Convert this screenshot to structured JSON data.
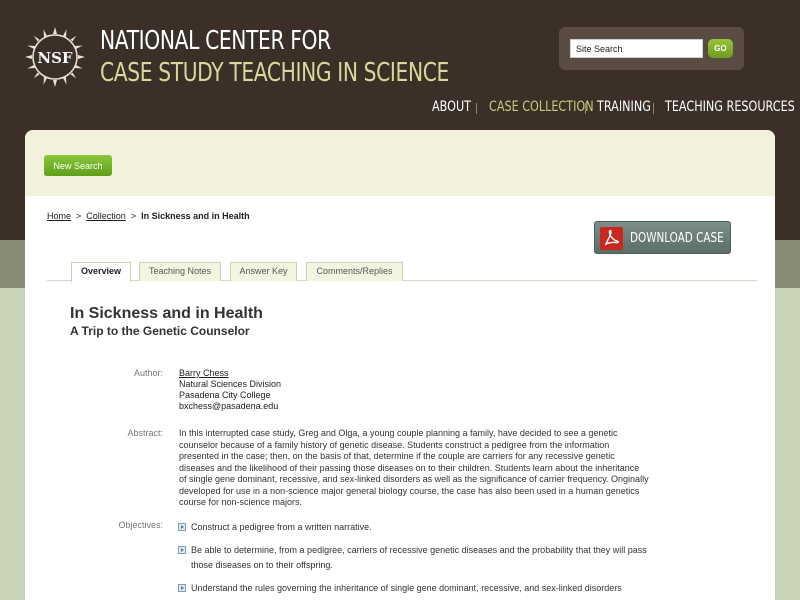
{
  "header": {
    "logo_text": "NSF",
    "title_line1": "NATIONAL CENTER FOR",
    "title_line2": "CASE STUDY TEACHING IN SCIENCE",
    "search": {
      "value": "Site Search",
      "go_label": "GO"
    },
    "nav": [
      "ABOUT",
      "CASE COLLECTION",
      "TRAINING",
      "TEACHING RESOURCES"
    ],
    "nav_active": "CASE COLLECTION"
  },
  "toolbar": {
    "new_search_label": "New Search"
  },
  "breadcrumb": {
    "home": "Home",
    "collection": "Collection",
    "current": "In Sickness and in Health",
    "separator": ">"
  },
  "download_label": "DOWNLOAD CASE",
  "tabs": [
    "Overview",
    "Teaching Notes",
    "Answer Key",
    "Comments/Replies"
  ],
  "case": {
    "title": "In Sickness and in Health",
    "subtitle": "A Trip to the Genetic Counselor",
    "author_label": "Author:",
    "author": {
      "name": "Barry Chess",
      "division": "Natural Sciences Division",
      "institution": "Pasadena City College",
      "email": "bxchess@pasadena.edu"
    },
    "abstract_label": "Abstract:",
    "abstract": "In this interrupted case study, Greg and Olga, a young couple planning a family, have decided to see a genetic counselor because of a family history of genetic disease. Students construct a pedigree from the information presented in the case; then, on the basis of that, determine if the couple are carriers for any recessive genetic diseases and the likelihood of their passing those diseases on to their children. Students learn about the inheritance of single gene dominant, recessive, and sex-linked disorders as well as the significance of carrier frequency. Originally developed for use in a non-science major general biology course, the case has also been used in a human genetics course for non-science majors.",
    "objectives_label": "Objectives:",
    "objectives": [
      "Construct a pedigree from a written narrative.",
      "Be able to determine, from a pedigree, carriers of recessive genetic diseases and the probability that they will pass those diseases on to their offspring.",
      "Understand the rules governing the inheritance of single gene dominant, recessive, and sex-linked disorders"
    ]
  },
  "colors": {
    "header_bg": "#3b2f28",
    "title_accent": "#d7d99a",
    "nav_active": "#c8cc7a",
    "button_green": "#6fae2a",
    "pdf_red": "#c8281d"
  },
  "icons": {
    "logo": "nsf-seal-icon",
    "download": "pdf-icon",
    "objective_bullet": "arrow-bullet-icon"
  }
}
